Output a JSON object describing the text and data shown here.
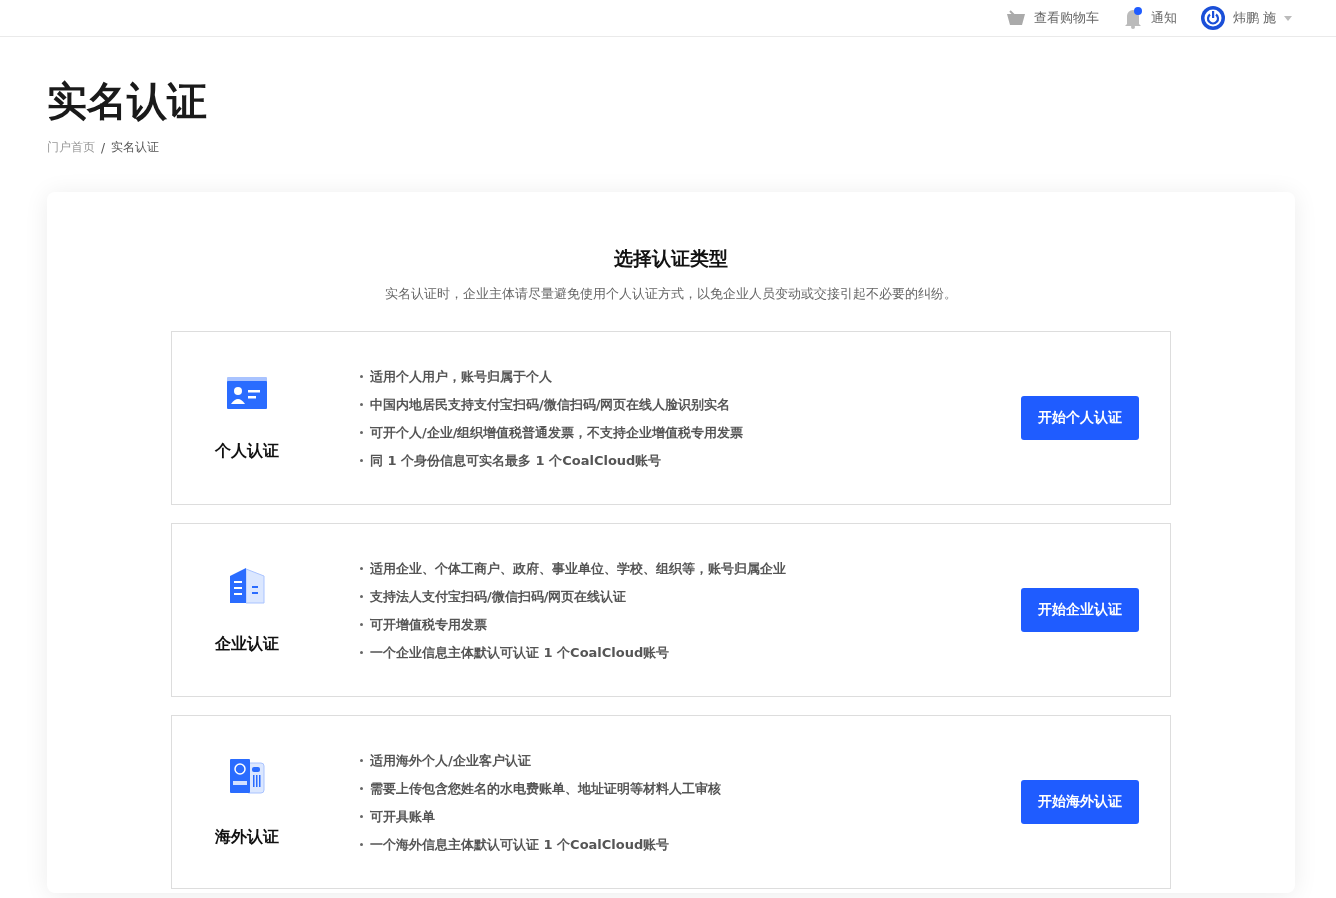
{
  "header": {
    "cart": "查看购物车",
    "notifications": {
      "label": "通知",
      "unread": true
    },
    "user": "炜鹏 施"
  },
  "page": {
    "title": "实名认证",
    "separator": "/",
    "breadcrumb": [
      {
        "label": "门户首页",
        "selected": false
      },
      {
        "label": "实名认证",
        "selected": true
      }
    ]
  },
  "panel": {
    "title": "选择认证类型",
    "subtitle": "实名认证时，企业主体请尽量避免使用个人认证方式，以免企业人员变动或交接引起不必要的纠纷。",
    "options": [
      {
        "kind": "person",
        "name": "个人认证",
        "points": [
          "适用个人用户，账号归属于个人",
          "中国内地居民支持支付宝扫码/微信扫码/网页在线人脸识别实名",
          "可开个人/企业/组织增值税普通发票，不支持企业增值税专用发票",
          "同 1 个身份信息可实名最多 1 个CoalCloud账号"
        ],
        "button": "开始个人认证"
      },
      {
        "kind": "building",
        "name": "企业认证",
        "points": [
          "适用企业、个体工商户、政府、事业单位、学校、组织等，账号归属企业",
          "支持法人支付宝扫码/微信扫码/网页在线认证",
          "可开增值税专用发票",
          "一个企业信息主体默认可认证 1 个CoalCloud账号"
        ],
        "button": "开始企业认证"
      },
      {
        "kind": "passport",
        "name": "海外认证",
        "points": [
          "适用海外个人/企业客户认证",
          "需要上传包含您姓名的水电费账单、地址证明等材料人工审核",
          "可开具账单",
          "一个海外信息主体默认可认证 1 个CoalCloud账号"
        ],
        "button": "开始海外认证"
      }
    ]
  }
}
